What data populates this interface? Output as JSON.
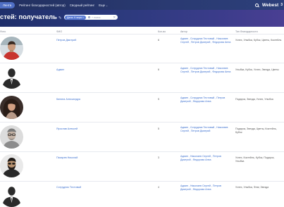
{
  "nav": {
    "items": [
      {
        "label": "Лента",
        "active": true
      },
      {
        "label": "Рейтинг благодарностей (автор)",
        "active": false
      },
      {
        "label": "Сводный рейтинг",
        "active": false
      },
      {
        "label": "Еще",
        "active": false
      }
    ],
    "more_caret": "⌄",
    "brand": "Webest",
    "brand_badge": "3"
  },
  "header": {
    "title": "стей: получатель",
    "edit_glyph": "✎",
    "filter_tag": "Дата: 9 чера",
    "filter_tag_close": "×",
    "search_placeholder": "+ поиск",
    "clear_glyph": "✕"
  },
  "table": {
    "columns": [
      "Фото",
      "ФИО",
      "Кол-во",
      "Автор",
      "Тип благодарности"
    ],
    "rows": [
      {
        "name": "Петров Дмитрий",
        "count": "6",
        "authors": "Админ , Сотрудник Тестовый , Николаев Сергей , Петров Дмитрий , Федорова Анна",
        "types": "Успех, Улыбка, Кубок, Цветы, Коктейль",
        "avatar": "photo-man-red-shirt"
      },
      {
        "name": "Админ",
        "count": "6",
        "authors": "Админ , Сотрудник Тестовый , Николаев Сергей , Петров Дмитрий , Федорова Анна",
        "types": "Улыбка, Кубок, Успех, Звезда, Цветы",
        "avatar": "silhouette-placeholder"
      },
      {
        "name": "Кипина Александра",
        "count": "5",
        "authors": "Админ , Сотрудник Тестовый , Петров Дмитрий , Федорова Анна",
        "types": "Подарок, Звезда, Успех, Улыбка",
        "avatar": "photo-woman-curly"
      },
      {
        "name": "Ярослав Алексей",
        "count": "5",
        "authors": "Админ , Сотрудник Тестовый , Николаев Сергей , Петров Дмитрий",
        "types": "Подарок, Звезда, Цветы, Коктейль, Кубок",
        "avatar": "photo-man-glasses"
      },
      {
        "name": "Пахарев Николай",
        "count": "3",
        "authors": "Админ , Николаев Сергей , Петров Дмитрий , Федорова Анна",
        "types": "Успех, Коктейль, Кубок, Подарок, Улыбка",
        "avatar": "photo-man-beard"
      },
      {
        "name": "Сотрудник Тестовый",
        "count": "4",
        "authors": "Админ , Николаев Сергей , Петров Дмитрий , Федорова Анна",
        "types": "Успех, Улыбка, Флаг, Звезда",
        "avatar": "silhouette-placeholder"
      }
    ]
  },
  "colors": {
    "link": "#3b6fcf",
    "topbar": "#22305f",
    "active_tab": "#4f6fc4",
    "header_gradient_end": "#4a3f93"
  }
}
